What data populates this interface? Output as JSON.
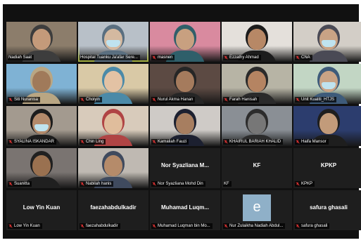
{
  "app": {
    "name": "Zoom Gallery View"
  },
  "colors": {
    "active_border": "#c9d84a",
    "window_bg": "#111111",
    "tile_bg": "#1e1e1e",
    "muted_mic": "#e03333"
  },
  "participants": [
    {
      "name": "Nadiah Saat",
      "muted": false,
      "video": true,
      "bg": "#8c7d6b",
      "skin": "#c49a7a",
      "cloth": "#3d3d3d"
    },
    {
      "name": "Hospital Tuanku Ja'afar Sere...",
      "muted": false,
      "video": true,
      "active": true,
      "bg": "#b8c0c8",
      "skin": "#d4b9a0",
      "cloth": "#5a6f80",
      "mask": true
    },
    {
      "name": "masnen",
      "muted": true,
      "video": true,
      "bg": "#d98a9f",
      "skin": "#c8a080",
      "cloth": "#2f5f6a"
    },
    {
      "name": "Ezzathy Ahmad",
      "muted": true,
      "video": true,
      "bg": "#e4e0db",
      "skin": "#b78866",
      "cloth": "#1c1c1c"
    },
    {
      "name": "CNA",
      "muted": true,
      "video": true,
      "bg": "#d3cec7",
      "skin": "#c9a385",
      "cloth": "#4a4a55",
      "mask": true
    },
    {
      "name": "Siti Nuranisa",
      "muted": true,
      "video": true,
      "bg": "#7fb2d4",
      "skin": "#a07a5a",
      "cloth": "#b9a683"
    },
    {
      "name": "Choiyin",
      "muted": true,
      "video": true,
      "bg": "#d9c9a6",
      "skin": "#e3c2a4",
      "cloth": "#4b8aa8"
    },
    {
      "name": "Nurul Akma Hanan",
      "muted": true,
      "video": true,
      "bg": "#5c4a43",
      "skin": "#a57b5d",
      "cloth": "#262626"
    },
    {
      "name": "Farah Hanisah",
      "muted": true,
      "video": true,
      "bg": "#b7b4a5",
      "skin": "#b58462",
      "cloth": "#2a2a2a"
    },
    {
      "name": "Unit Kualiti_HTJS",
      "muted": true,
      "video": true,
      "bg": "#c2d6c4",
      "skin": "#c9a385",
      "cloth": "#3e5b7a",
      "mask": true
    },
    {
      "name": "SYALINA ISKANDAR",
      "muted": true,
      "video": true,
      "bg": "#a39a8f",
      "skin": "#b38a6b",
      "cloth": "#1d1d1d",
      "mask": true
    },
    {
      "name": "Chin Ling",
      "muted": true,
      "video": true,
      "bg": "#d8cbbb",
      "skin": "#e0bd9c",
      "cloth": "#b04444"
    },
    {
      "name": "Kamaliah Fauzi",
      "muted": true,
      "video": true,
      "bg": "#cfcbc7",
      "skin": "#a77e60",
      "cloth": "#1c2030"
    },
    {
      "name": "KHAIRUL BARIAH KHALID",
      "muted": true,
      "video": true,
      "bg": "#8a8f95",
      "skin": "#777777",
      "cloth": "#2c2c2c"
    },
    {
      "name": "Haifa Mansor",
      "muted": true,
      "video": true,
      "bg": "#2c3d6e",
      "skin": "#c29b7a",
      "cloth": "#1e1e1e"
    },
    {
      "name": "Suanitta",
      "muted": true,
      "video": true,
      "bg": "#7a7471",
      "skin": "#9a7150",
      "cloth": "#202020"
    },
    {
      "name": "Nabilah hanis",
      "muted": true,
      "video": true,
      "bg": "#bfb9b2",
      "skin": "#b58b6a",
      "cloth": "#3f4a5e"
    },
    {
      "name": "Nor Syazliana Mohd Din",
      "display": "Nor Syazliana M...",
      "muted": true,
      "video": false
    },
    {
      "name": "KF",
      "display": "KF",
      "muted": false,
      "video": false
    },
    {
      "name": "KPKP",
      "display": "KPKP",
      "muted": true,
      "video": false
    },
    {
      "name": "Low Yin Kuan",
      "display": "Low Yin Kuan",
      "muted": true,
      "video": false
    },
    {
      "name": "faezahabdulkadir",
      "display": "faezahabdulkadir",
      "muted": true,
      "video": false
    },
    {
      "name": "Muhamad Luqman bin Mo...",
      "display": "Muhamad Luqm...",
      "muted": true,
      "video": false
    },
    {
      "name": "Nur Zulaikha Nadiah Abdul...",
      "avatar": "e",
      "muted": true,
      "video": false
    },
    {
      "name": "safura ghasali",
      "display": "safura ghasali",
      "muted": true,
      "video": false
    }
  ]
}
